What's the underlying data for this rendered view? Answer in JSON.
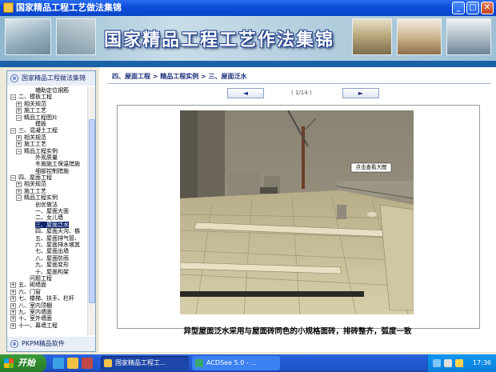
{
  "window": {
    "title": "国家精品工程工艺做法集锦",
    "controls": {
      "minimize": "_",
      "maximize": "□",
      "close": "✕"
    }
  },
  "banner": {
    "title": "国家精品工程工艺作法集锦"
  },
  "sidebar": {
    "header": "国家精品工程做法集锦",
    "header_icon": "⊗",
    "footer": "PKPM精品软件",
    "footer_icon": "⊗",
    "tree": [
      {
        "label": "辅助定位钢筋",
        "indent": 3,
        "pm": ""
      },
      {
        "label": "二、模板工程",
        "indent": 0,
        "pm": "−"
      },
      {
        "label": "相关规范",
        "indent": 1,
        "pm": "+"
      },
      {
        "label": "施工工艺",
        "indent": 1,
        "pm": "+"
      },
      {
        "label": "精品工程图片",
        "indent": 1,
        "pm": "−"
      },
      {
        "label": "模板",
        "indent": 3,
        "pm": ""
      },
      {
        "label": "三、混凝土工程",
        "indent": 0,
        "pm": "−"
      },
      {
        "label": "相关规范",
        "indent": 1,
        "pm": "+"
      },
      {
        "label": "施工工艺",
        "indent": 1,
        "pm": "+"
      },
      {
        "label": "精品工程实例",
        "indent": 1,
        "pm": "−"
      },
      {
        "label": "外观质量",
        "indent": 3,
        "pm": ""
      },
      {
        "label": "冬施施工保温措施",
        "indent": 3,
        "pm": ""
      },
      {
        "label": "细部控制措施",
        "indent": 3,
        "pm": ""
      },
      {
        "label": "四、屋面工程",
        "indent": 0,
        "pm": "−"
      },
      {
        "label": "相关规范",
        "indent": 1,
        "pm": "+"
      },
      {
        "label": "施工工艺",
        "indent": 1,
        "pm": "+"
      },
      {
        "label": "精品工程实例",
        "indent": 1,
        "pm": "−"
      },
      {
        "label": "创优做法",
        "indent": 3,
        "pm": ""
      },
      {
        "label": "一、屋面大面",
        "indent": 3,
        "pm": ""
      },
      {
        "label": "二、女儿墙",
        "indent": 3,
        "pm": ""
      },
      {
        "label": "三、屋面泛水",
        "indent": 3,
        "pm": "",
        "selected": true
      },
      {
        "label": "四、屋面天沟、檐",
        "indent": 3,
        "pm": ""
      },
      {
        "label": "五、屋面排气管、",
        "indent": 3,
        "pm": ""
      },
      {
        "label": "六、屋面排水坡其",
        "indent": 3,
        "pm": ""
      },
      {
        "label": "七、屋面出墙",
        "indent": 3,
        "pm": ""
      },
      {
        "label": "八、屋面防雨",
        "indent": 3,
        "pm": ""
      },
      {
        "label": "九、屋面变形",
        "indent": 3,
        "pm": ""
      },
      {
        "label": "十、屋面构架",
        "indent": 3,
        "pm": ""
      },
      {
        "label": "问题工程",
        "indent": 2,
        "pm": ""
      },
      {
        "label": "五、砌墙面",
        "indent": 0,
        "pm": "+"
      },
      {
        "label": "六、门窗",
        "indent": 0,
        "pm": "+"
      },
      {
        "label": "七、楼梯、扶手、栏杆",
        "indent": 0,
        "pm": "+"
      },
      {
        "label": "八、室内顶棚",
        "indent": 0,
        "pm": "+"
      },
      {
        "label": "九、室内墙面",
        "indent": 0,
        "pm": "+"
      },
      {
        "label": "十、室外墙面",
        "indent": 0,
        "pm": "+"
      },
      {
        "label": "十一、幕墙工程",
        "indent": 0,
        "pm": "+"
      }
    ]
  },
  "main": {
    "breadcrumb": "四、屋面工程 > 精品工程实例 > 三、屋面泛水",
    "prev_label": "◄",
    "next_label": "►",
    "pager": "( 1/14 )",
    "photo_tooltip": "点击查看大图",
    "caption": "异型屋面泛水采用与屋面砖同色的小规格面砖，排砖整齐，弧度一致"
  },
  "taskbar": {
    "start_label": "开始",
    "tasks": [
      {
        "label": "国家精品工程工...",
        "active": true
      },
      {
        "label": "ACDSee 5.0 - ...",
        "active": false
      }
    ],
    "clock": "17:36"
  }
}
